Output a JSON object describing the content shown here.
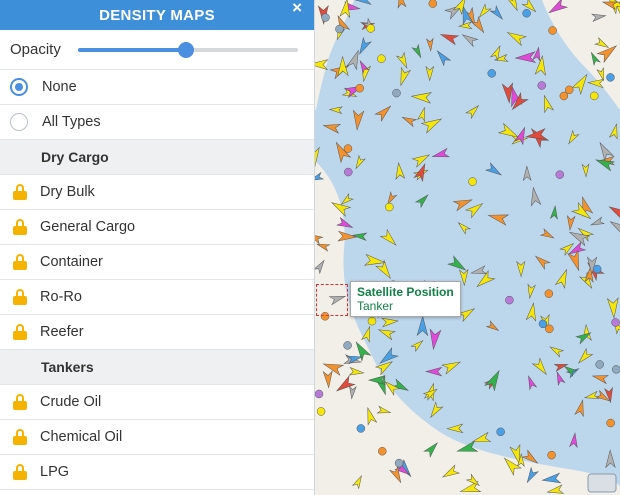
{
  "panel": {
    "title": "DENSITY MAPS",
    "close_icon": "×",
    "opacity_label": "Opacity",
    "opacity_value": 0.49
  },
  "options": [
    {
      "label": "None",
      "checked": true
    },
    {
      "label": "All Types",
      "checked": false
    }
  ],
  "sections": [
    {
      "title": "Dry Cargo",
      "items": [
        "Dry Bulk",
        "General Cargo",
        "Container",
        "Ro-Ro",
        "Reefer"
      ]
    },
    {
      "title": "Tankers",
      "items": [
        "Crude Oil",
        "Chemical Oil",
        "LPG"
      ]
    }
  ],
  "tooltip": {
    "title": "Satellite Position",
    "subtitle": "Tanker"
  },
  "colors": {
    "header": "#3d8fd9",
    "accent": "#4a8fe0",
    "lock": "#f5b301",
    "tooltip_text": "#118246"
  }
}
